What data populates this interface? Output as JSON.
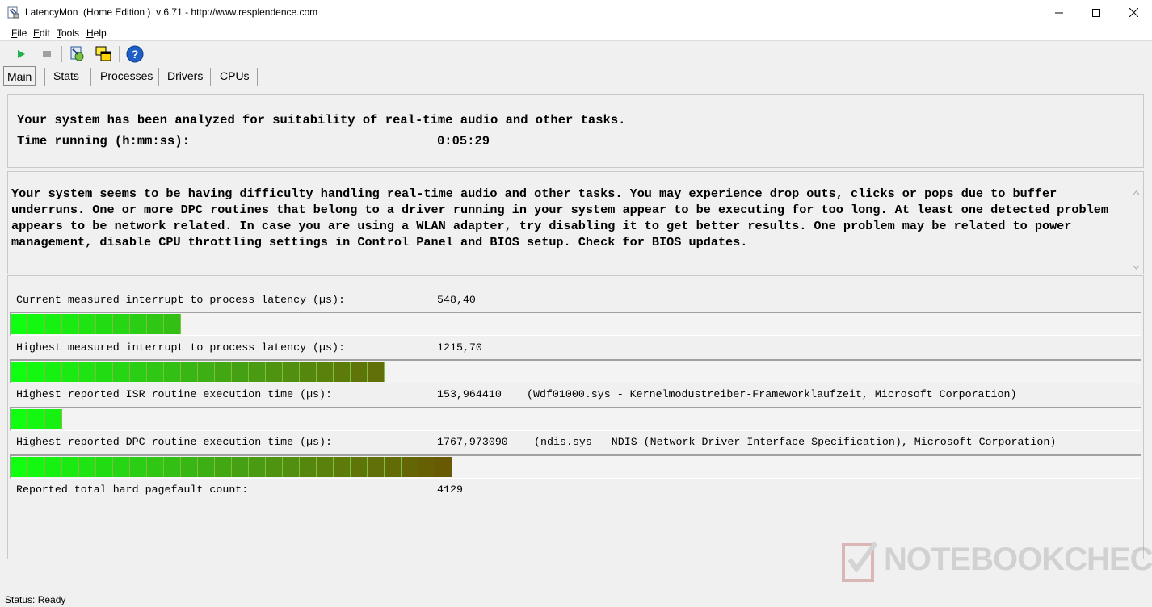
{
  "window": {
    "title": "LatencyMon  (Home Edition )  v 6.71 - http://www.resplendence.com"
  },
  "menu": [
    {
      "underline": "F",
      "rest": "ile"
    },
    {
      "underline": "E",
      "rest": "dit"
    },
    {
      "underline": "T",
      "rest": "ools"
    },
    {
      "underline": "H",
      "rest": "elp"
    }
  ],
  "toolbar": {
    "icons": [
      "play-icon",
      "stop-icon",
      "kernel-timers-icon",
      "windows-icon",
      "help-icon"
    ]
  },
  "tabs": [
    "Main",
    "Stats",
    "Processes",
    "Drivers",
    "CPUs"
  ],
  "summary": {
    "analyzed": "Your system has been analyzed for suitability of real-time audio and other tasks.",
    "time_label": "Time running (h:mm:ss):",
    "time_value": "0:05:29"
  },
  "message": "Your system seems to be having difficulty handling real-time audio and other tasks. You may experience drop outs, clicks or pops due to buffer underruns. One or more DPC routines that belong to a driver running in your system appear to be executing for too long. At least one detected problem appears to be network related. In case you are using a WLAN adapter, try disabling it to get better results. One problem may be related to power management, disable CPU throttling settings in Control Panel and BIOS setup. Check for BIOS updates.",
  "metrics": [
    {
      "label": "Current measured interrupt to process latency (µs):",
      "value": "548,40",
      "driver": "",
      "segments": 10
    },
    {
      "label": "Highest measured interrupt to process latency (µs):",
      "value": "1215,70",
      "driver": "",
      "segments": 22
    },
    {
      "label": "Highest reported ISR routine execution time (µs):",
      "value": "153,964410",
      "driver": "(Wdf01000.sys - Kernelmodustreiber-Frameworklaufzeit, Microsoft Corporation)",
      "segments": 3
    },
    {
      "label": "Highest reported DPC routine execution time (µs):",
      "value": "1767,973090",
      "driver": "(ndis.sys - NDIS (Network Driver Interface Specification), Microsoft Corporation)",
      "segments": 26
    }
  ],
  "pagefault": {
    "label": "Reported total hard pagefault count:",
    "value": "4129"
  },
  "status": "Status: Ready",
  "watermark": "NOTEBOOKCHECK"
}
